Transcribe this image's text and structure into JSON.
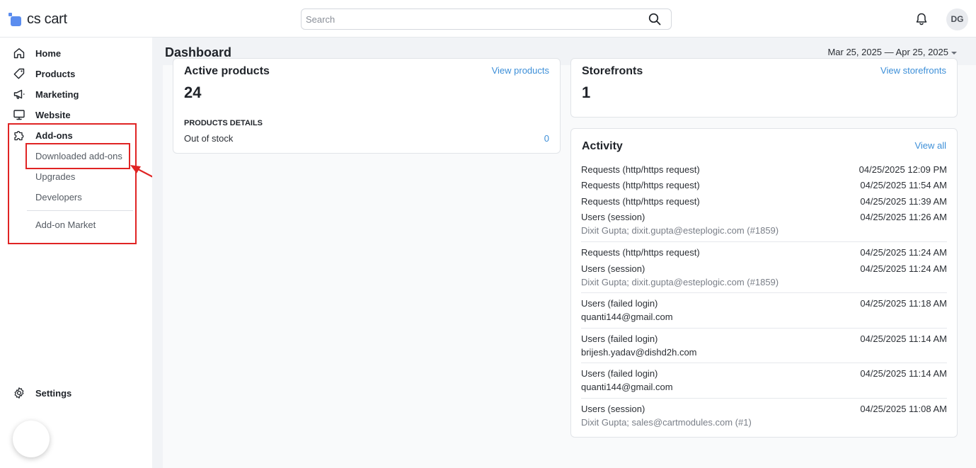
{
  "app": {
    "logo_text": "cs cart"
  },
  "search": {
    "placeholder": "Search"
  },
  "user": {
    "initials": "DG"
  },
  "sidebar": {
    "items": [
      {
        "label": "Home",
        "icon": "home-icon"
      },
      {
        "label": "Products",
        "icon": "tag-icon"
      },
      {
        "label": "Marketing",
        "icon": "megaphone-icon"
      },
      {
        "label": "Website",
        "icon": "monitor-icon"
      },
      {
        "label": "Add-ons",
        "icon": "puzzle-icon"
      }
    ],
    "addons_sub": [
      "Downloaded add-ons",
      "Upgrades",
      "Developers",
      "Add-on Market"
    ],
    "settings_label": "Settings"
  },
  "header": {
    "title": "Dashboard",
    "date_range": "Mar 25, 2025 — Apr 25, 2025"
  },
  "active_products": {
    "title": "Active products",
    "link": "View products",
    "count": "24",
    "details_heading": "PRODUCTS DETAILS",
    "out_of_stock_label": "Out of stock",
    "out_of_stock_value": "0"
  },
  "storefronts": {
    "title": "Storefronts",
    "link": "View storefronts",
    "count": "1"
  },
  "activity": {
    "title": "Activity",
    "link": "View all",
    "groups": [
      {
        "entries": [
          {
            "type": "Requests (http/https request)",
            "time": "04/25/2025 12:09 PM"
          },
          {
            "type": "Requests (http/https request)",
            "time": "04/25/2025 11:54 AM"
          },
          {
            "type": "Requests (http/https request)",
            "time": "04/25/2025 11:39 AM"
          },
          {
            "type": "Users (session)",
            "time": "04/25/2025 11:26 AM",
            "detail": "Dixit Gupta; dixit.gupta@esteplogic.com (#1859)"
          }
        ]
      },
      {
        "entries": [
          {
            "type": "Requests (http/https request)",
            "time": "04/25/2025 11:24 AM"
          },
          {
            "type": "Users (session)",
            "time": "04/25/2025 11:24 AM",
            "detail": "Dixit Gupta; dixit.gupta@esteplogic.com (#1859)"
          }
        ]
      },
      {
        "entries": [
          {
            "type": "Users (failed login)",
            "time": "04/25/2025 11:18 AM",
            "detail": "quanti144@gmail.com"
          }
        ]
      },
      {
        "entries": [
          {
            "type": "Users (failed login)",
            "time": "04/25/2025 11:14 AM",
            "detail": "brijesh.yadav@dishd2h.com"
          }
        ]
      },
      {
        "entries": [
          {
            "type": "Users (failed login)",
            "time": "04/25/2025 11:14 AM",
            "detail": "quanti144@gmail.com"
          }
        ]
      },
      {
        "entries": [
          {
            "type": "Users (session)",
            "time": "04/25/2025 11:08 AM",
            "detail": "Dixit Gupta; sales@cartmodules.com (#1)"
          }
        ]
      }
    ]
  },
  "colors": {
    "accent": "#3d8fd8",
    "annotation": "#e02424",
    "brand": "#5b8def"
  }
}
